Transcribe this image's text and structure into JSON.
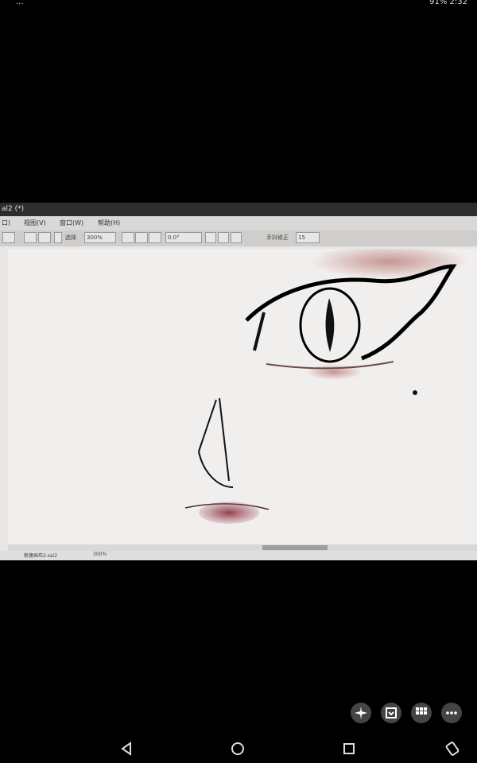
{
  "status": {
    "left": "...",
    "right": "91% 2:32"
  },
  "app": {
    "window_title": "al2 (*)",
    "menus": [
      "口)",
      "视图(V)",
      "窗口(W)",
      "帮助(H)"
    ],
    "toolbar": {
      "select_label": "选择",
      "zoom": "300%",
      "rotation": "0.0°",
      "stabilizer_label": "手抖修正",
      "stabilizer_value": "15"
    },
    "document_tab": {
      "name": "新建画布2.sai2",
      "zoom": "300%"
    }
  },
  "icons": {
    "float": [
      "sparkle-icon",
      "save-icon",
      "grid-icon",
      "more-icon"
    ],
    "nav": [
      "back-icon",
      "home-icon",
      "recent-apps-icon",
      "rotate-icon"
    ]
  }
}
